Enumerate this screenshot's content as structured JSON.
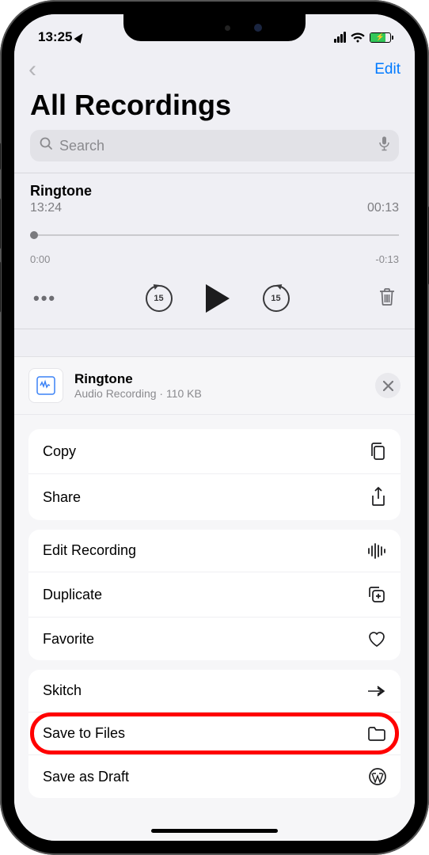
{
  "status": {
    "time": "13:25"
  },
  "nav": {
    "edit_label": "Edit"
  },
  "page": {
    "title": "All Recordings"
  },
  "search": {
    "placeholder": "Search"
  },
  "recording": {
    "title": "Ringtone",
    "timestamp": "13:24",
    "duration": "00:13",
    "elapsed": "0:00",
    "remaining": "-0:13",
    "skip_back_seconds": "15",
    "skip_fwd_seconds": "15"
  },
  "sheet": {
    "file_name": "Ringtone",
    "file_meta": "Audio Recording · 110 KB",
    "actions": {
      "copy": "Copy",
      "share": "Share",
      "edit": "Edit Recording",
      "duplicate": "Duplicate",
      "favorite": "Favorite",
      "skitch": "Skitch",
      "save_files": "Save to Files",
      "save_draft": "Save as Draft"
    }
  }
}
